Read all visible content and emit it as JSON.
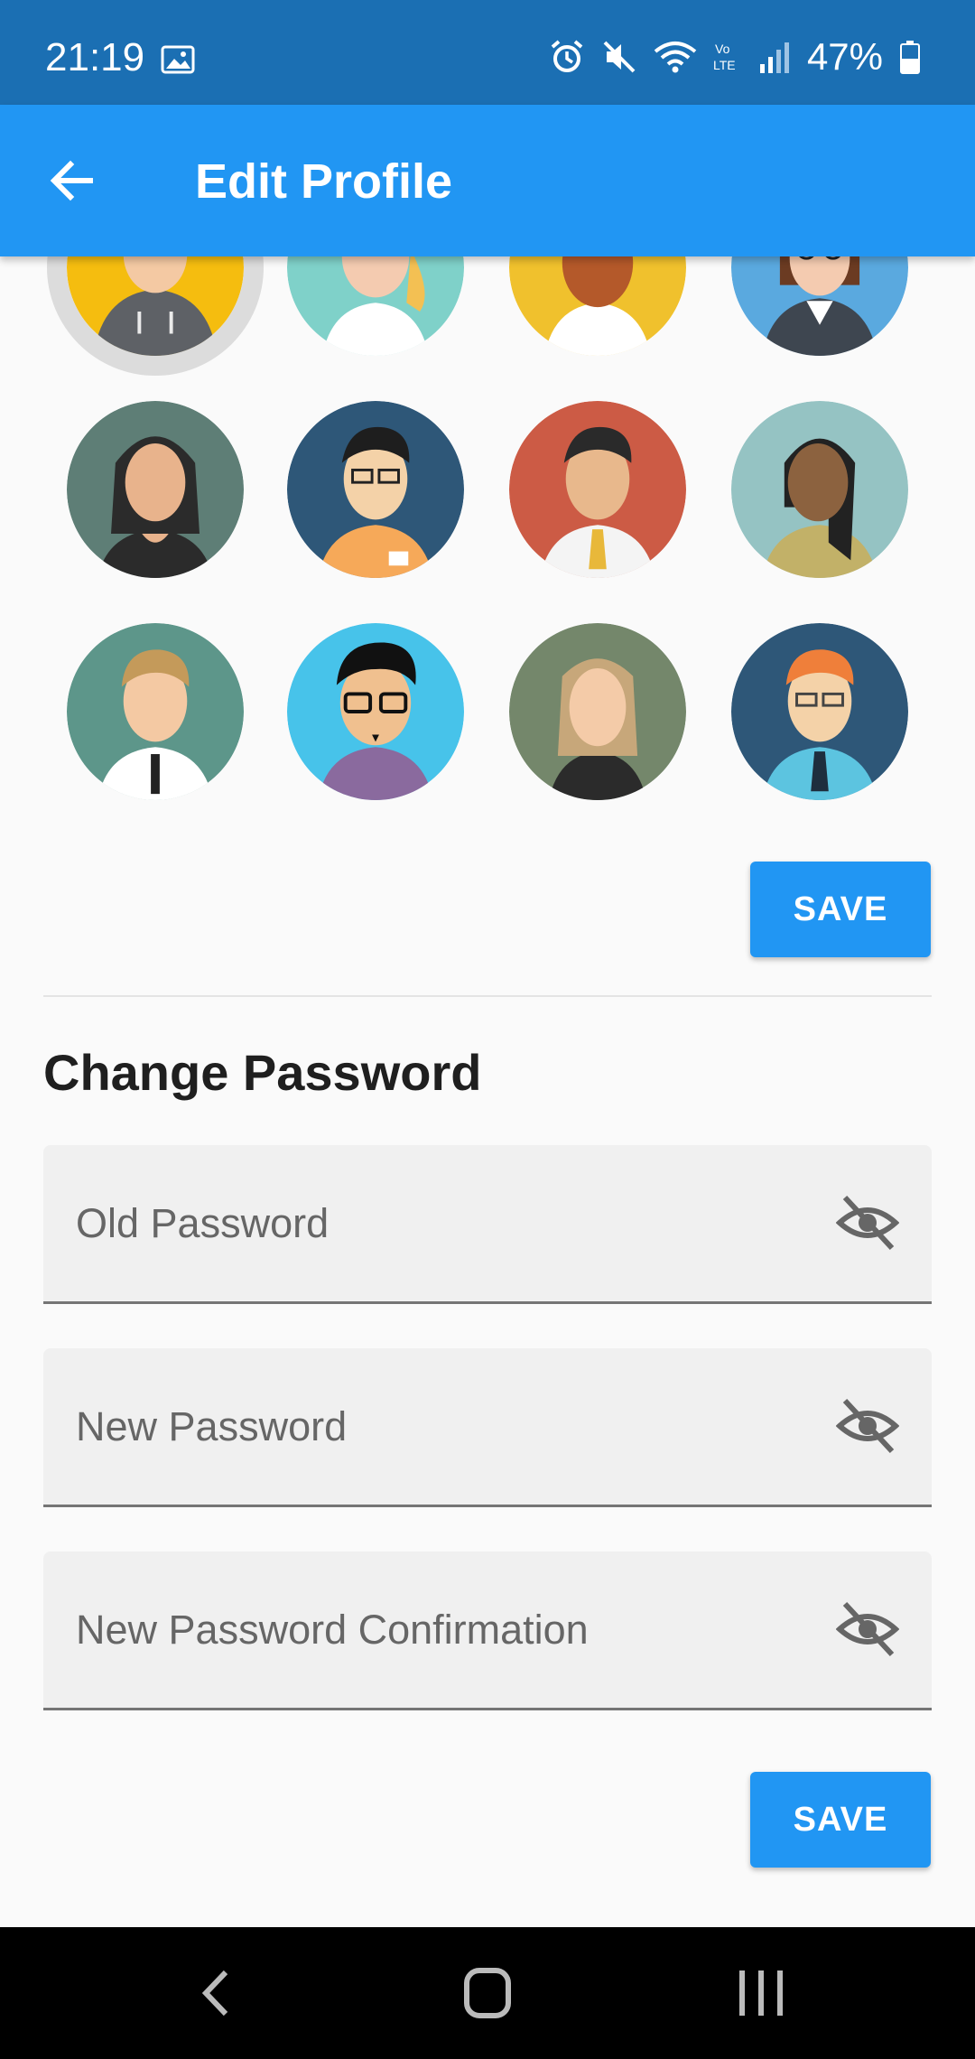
{
  "status_bar": {
    "time": "21:19",
    "battery": "47%",
    "icons": [
      "gallery-icon",
      "alarm-icon",
      "mute-icon",
      "wifi-icon",
      "volte-icon",
      "signal-icon",
      "battery-icon"
    ]
  },
  "app_bar": {
    "title": "Edit Profile",
    "back_icon": "arrow-back-icon"
  },
  "avatars": {
    "selected_index": 0,
    "items": [
      {
        "bg": "#f5bd0f"
      },
      {
        "bg": "#7fd1c9"
      },
      {
        "bg": "#f0c12d"
      },
      {
        "bg": "#5aa9df"
      },
      {
        "bg": "#5e7e76"
      },
      {
        "bg": "#2e5778"
      },
      {
        "bg": "#cc5b45"
      },
      {
        "bg": "#95c3c3"
      },
      {
        "bg": "#5d968a"
      },
      {
        "bg": "#47c3ea"
      },
      {
        "bg": "#74876b"
      },
      {
        "bg": "#2e5778"
      }
    ]
  },
  "profile": {
    "save_label": "SAVE"
  },
  "change_password": {
    "title": "Change Password",
    "fields": [
      {
        "placeholder": "Old Password",
        "icon": "visibility-off-icon"
      },
      {
        "placeholder": "New Password",
        "icon": "visibility-off-icon"
      },
      {
        "placeholder": "New Password Confirmation",
        "icon": "visibility-off-icon"
      }
    ],
    "save_label": "SAVE"
  },
  "nav_bar": {
    "icons": [
      "nav-back-icon",
      "home-icon",
      "recents-icon"
    ]
  },
  "colors": {
    "primary": "#2196f3",
    "status_bar": "#1b6fb3",
    "background": "#fafafa"
  }
}
